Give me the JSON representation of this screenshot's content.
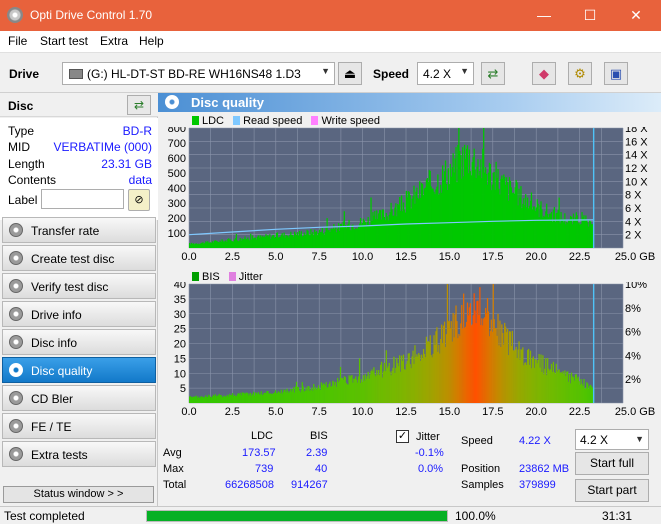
{
  "window": {
    "title": "Opti Drive Control 1.70",
    "minimize_glyph": "—",
    "maximize_glyph": "☐",
    "close_glyph": "✕"
  },
  "menu": [
    "File",
    "Start test",
    "Extra",
    "Help"
  ],
  "toolbar": {
    "drive_label": "Drive",
    "drive_value": "(G:)  HL-DT-ST BD-RE  WH16NS48 1.D3",
    "speed_label": "Speed",
    "speed_value": "4.2 X"
  },
  "disc": {
    "header": "Disc",
    "rows": [
      {
        "key": "Type",
        "value": "BD-R"
      },
      {
        "key": "MID",
        "value": "VERBATIMe (000)"
      },
      {
        "key": "Length",
        "value": "23.31 GB"
      },
      {
        "key": "Contents",
        "value": "data"
      }
    ],
    "label_key": "Label",
    "label_value": ""
  },
  "nav": [
    {
      "label": "Transfer rate",
      "active": false
    },
    {
      "label": "Create test disc",
      "active": false
    },
    {
      "label": "Verify test disc",
      "active": false
    },
    {
      "label": "Drive info",
      "active": false
    },
    {
      "label": "Disc info",
      "active": false
    },
    {
      "label": "Disc quality",
      "active": true
    },
    {
      "label": "CD Bler",
      "active": false
    },
    {
      "label": "FE / TE",
      "active": false
    },
    {
      "label": "Extra tests",
      "active": false
    }
  ],
  "status_window_label": "Status window > >",
  "panel_title": "Disc quality",
  "colors": {
    "ldc": "#00c800",
    "read_speed": "#7ec8ff",
    "write_speed": "#ff80ff",
    "bis": "#00a000",
    "jitter": "#e080e0",
    "chart_bg": "#5a6680",
    "grid": "#8a94aa"
  },
  "chart_data": [
    {
      "type": "area",
      "legend": [
        "LDC",
        "Read speed",
        "Write speed"
      ],
      "x_ticks": [
        "0.0",
        "2.5",
        "5.0",
        "7.5",
        "10.0",
        "12.5",
        "15.0",
        "17.5",
        "20.0",
        "22.5",
        "25.0 GB"
      ],
      "y_left_ticks": [
        "100",
        "200",
        "300",
        "400",
        "500",
        "600",
        "700",
        "800"
      ],
      "y_right_ticks": [
        "2 X",
        "4 X",
        "6 X",
        "8 X",
        "10 X",
        "12 X",
        "14 X",
        "16 X",
        "18 X"
      ],
      "xlim": [
        0,
        25
      ],
      "ylim": [
        0,
        800
      ],
      "y2lim": [
        0,
        18
      ],
      "ldc": {
        "x": [
          0,
          1,
          2.5,
          5,
          7.5,
          9,
          10,
          11,
          12,
          13,
          14,
          15,
          15.5,
          16,
          16.5,
          17,
          17.5,
          18,
          19,
          20,
          21,
          22,
          22.5,
          23,
          23.31
        ],
        "y": [
          30,
          40,
          60,
          90,
          120,
          160,
          190,
          230,
          290,
          380,
          470,
          560,
          620,
          680,
          640,
          580,
          520,
          470,
          380,
          300,
          240,
          200,
          220,
          180,
          120
        ]
      },
      "read_speed": {
        "x": [
          0,
          2.5,
          5,
          7.5,
          10,
          12.5,
          15,
          17.5,
          20,
          22.5,
          23.31
        ],
        "y": [
          2.0,
          2.4,
          2.8,
          3.1,
          3.3,
          3.6,
          3.8,
          4.0,
          4.15,
          4.2,
          4.22
        ]
      },
      "marker_x": 23.31
    },
    {
      "type": "area",
      "legend": [
        "BIS",
        "Jitter"
      ],
      "x_ticks": [
        "0.0",
        "2.5",
        "5.0",
        "7.5",
        "10.0",
        "12.5",
        "15.0",
        "17.5",
        "20.0",
        "22.5",
        "25.0 GB"
      ],
      "y_left_ticks": [
        "5",
        "10",
        "15",
        "20",
        "25",
        "30",
        "35",
        "40"
      ],
      "y_right_ticks": [
        "2%",
        "4%",
        "6%",
        "8%",
        "10%"
      ],
      "xlim": [
        0,
        25
      ],
      "ylim": [
        0,
        40
      ],
      "bis": {
        "x": [
          0,
          2.5,
          5,
          7.5,
          9,
          10,
          11,
          12,
          13,
          14,
          15,
          15.5,
          16,
          16.5,
          17,
          17.5,
          18,
          19,
          20,
          21,
          22,
          22.5,
          23,
          23.31
        ],
        "y": [
          2,
          3,
          4,
          6,
          8,
          9,
          12,
          14,
          17,
          21,
          26,
          30,
          34,
          37,
          33,
          29,
          25,
          19,
          15,
          12,
          9,
          8,
          6,
          4
        ]
      },
      "marker_x": 23.31
    }
  ],
  "stats": {
    "col_ldc": "LDC",
    "col_bis": "BIS",
    "jitter_label": "Jitter",
    "jitter_checked": "✓",
    "avg_label": "Avg",
    "max_label": "Max",
    "total_label": "Total",
    "avg_ldc": "173.57",
    "avg_bis": "2.39",
    "avg_jitter": "-0.1%",
    "max_ldc": "739",
    "max_bis": "40",
    "max_jitter": "0.0%",
    "total_ldc": "66268508",
    "total_bis": "914267",
    "speed_label": "Speed",
    "speed_value": "4.22 X",
    "position_label": "Position",
    "position_value": "23862 MB",
    "samples_label": "Samples",
    "samples_value": "379899",
    "speed_select": "4.2 X",
    "start_full": "Start full",
    "start_part": "Start part"
  },
  "status": {
    "text": "Test completed",
    "progress": 1.0,
    "percent": "100.0%",
    "time": "31:31"
  }
}
